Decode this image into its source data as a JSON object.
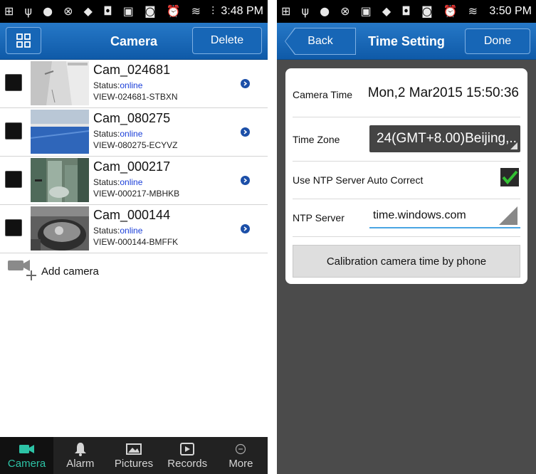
{
  "left": {
    "status_time": "3:48 PM",
    "status_icons": "⊞ ψ ● ⊗ ◆ ◘ ▣ ◙ ⏰ ≋ ⫶ ▮",
    "title": "Camera",
    "delete_label": "Delete",
    "cameras": [
      {
        "name": "Cam_024681",
        "status_label": "Status:",
        "status_value": "online",
        "device_id": "VIEW-024681-STBXN"
      },
      {
        "name": "Cam_080275",
        "status_label": "Status:",
        "status_value": "online",
        "device_id": "VIEW-080275-ECYVZ"
      },
      {
        "name": "Cam_000217",
        "status_label": "Status:",
        "status_value": "online",
        "device_id": "VIEW-000217-MBHKB"
      },
      {
        "name": "Cam_000144",
        "status_label": "Status:",
        "status_value": "online",
        "device_id": "VIEW-000144-BMFFK"
      }
    ],
    "add_camera_label": "Add camera",
    "tabs": [
      {
        "label": "Camera",
        "icon": "video-camera-icon",
        "active": true
      },
      {
        "label": "Alarm",
        "icon": "bell-icon",
        "active": false
      },
      {
        "label": "Pictures",
        "icon": "picture-icon",
        "active": false
      },
      {
        "label": "Records",
        "icon": "record-icon",
        "active": false
      },
      {
        "label": "More",
        "icon": "more-icon",
        "active": false
      }
    ]
  },
  "right": {
    "status_time": "3:50 PM",
    "status_icons": "⊞ ψ ● ⊗ ▣ ◆ ◘ ◙ ⏰ ≋ ⫶ ▮",
    "title": "Time Setting",
    "back_label": "Back",
    "done_label": "Done",
    "camera_time_label": "Camera Time",
    "camera_time_value": "Mon,2 Mar2015 15:50:36",
    "time_zone_label": "Time Zone",
    "time_zone_value": "24(GMT+8.00)Beijing,..",
    "ntp_auto_label": "Use NTP Server Auto Correct",
    "ntp_auto_checked": true,
    "ntp_server_label": "NTP Server",
    "ntp_server_value": "time.windows.com",
    "calibrate_label": "Calibration camera time by phone"
  },
  "colors": {
    "title_bar": "#1766b6",
    "active_tab": "#2dc3a6",
    "online": "#1a3ed8",
    "check_green": "#33c233"
  }
}
